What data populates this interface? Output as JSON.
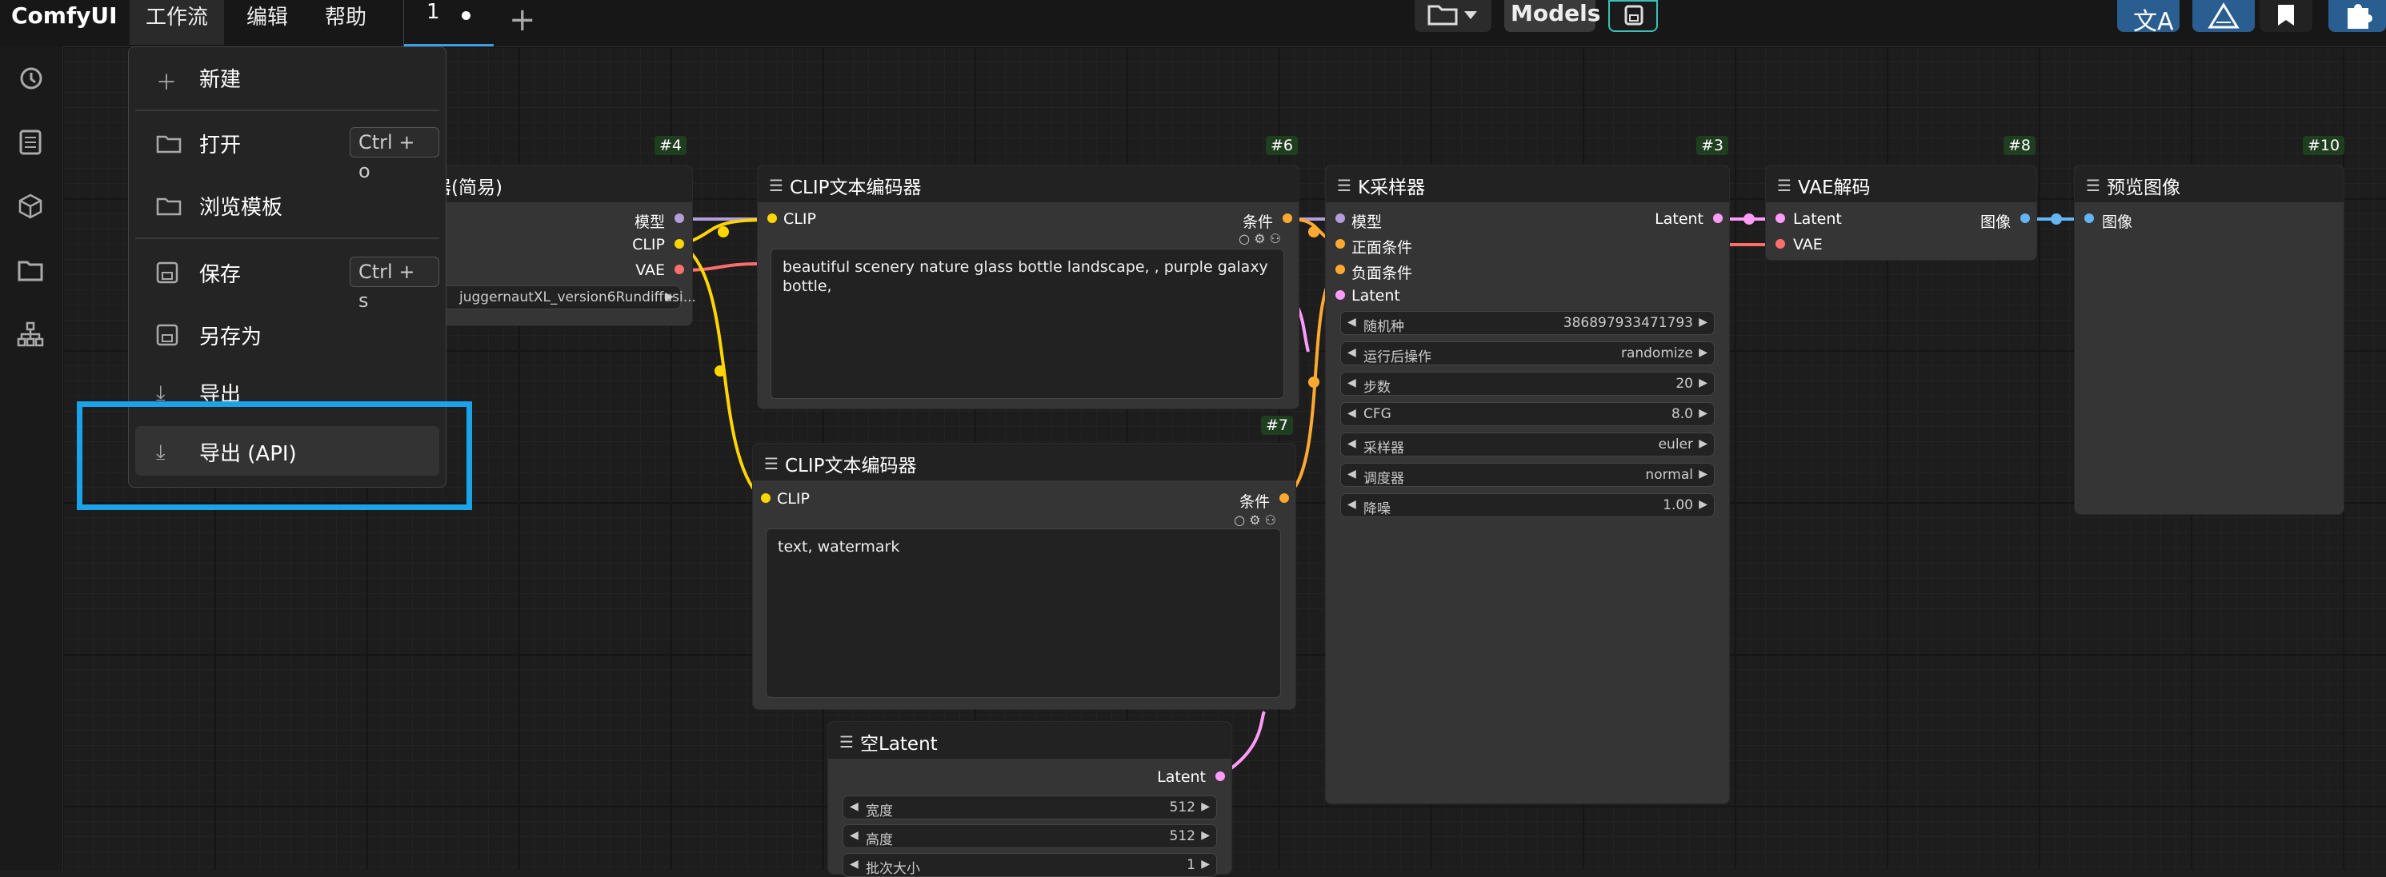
{
  "app": {
    "title": "ComfyUI"
  },
  "menubar": {
    "workflow": "工作流",
    "edit": "编辑",
    "help": "帮助"
  },
  "tab": {
    "label": "1"
  },
  "toolbar": {
    "models": "Models"
  },
  "dropdown": {
    "new": "新建",
    "open": "打开",
    "open_shortcut": "Ctrl + o",
    "browse_templates": "浏览模板",
    "save": "保存",
    "save_shortcut": "Ctrl + s",
    "save_as": "另存为",
    "export": "导出",
    "export_api": "导出 (API)"
  },
  "nodes": {
    "checkpoint": {
      "id": "#4",
      "title": "器(简易)",
      "outputs": [
        "模型",
        "CLIP",
        "VAE"
      ],
      "ckpt_value": "juggernautXL_version6Rundiffusi..."
    },
    "clip_pos": {
      "id": "#6",
      "title": "CLIP文本编码器",
      "input": "CLIP",
      "output": "条件",
      "text": "beautiful scenery nature glass bottle landscape, , purple galaxy bottle,"
    },
    "clip_neg": {
      "id": "#7",
      "title": "CLIP文本编码器",
      "input": "CLIP",
      "output": "条件",
      "text": "text, watermark"
    },
    "ksampler": {
      "id": "#3",
      "title": "K采样器",
      "inputs": [
        "模型",
        "正面条件",
        "负面条件",
        "Latent"
      ],
      "output": "Latent",
      "widgets": [
        {
          "label": "随机种",
          "value": "386897933471793"
        },
        {
          "label": "运行后操作",
          "value": "randomize"
        },
        {
          "label": "步数",
          "value": "20"
        },
        {
          "label": "CFG",
          "value": "8.0"
        },
        {
          "label": "采样器",
          "value": "euler"
        },
        {
          "label": "调度器",
          "value": "normal"
        },
        {
          "label": "降噪",
          "value": "1.00"
        }
      ]
    },
    "vae": {
      "id": "#8",
      "title": "VAE解码",
      "inputs": [
        "Latent",
        "VAE"
      ],
      "output": "图像"
    },
    "preview": {
      "id": "#10",
      "title": "预览图像",
      "input": "图像"
    },
    "empty_latent": {
      "title": "空Latent",
      "output": "Latent",
      "widgets": [
        {
          "label": "宽度",
          "value": "512"
        },
        {
          "label": "高度",
          "value": "512"
        },
        {
          "label": "批次大小",
          "value": "1"
        }
      ]
    }
  },
  "colors": {
    "accent": "#1aa3e8",
    "clip": "#ffd500",
    "model": "#b39ddb",
    "vae": "#ff6e6e",
    "latent": "#ff9cf9",
    "cond": "#ffa931",
    "image": "#64b5f6"
  }
}
